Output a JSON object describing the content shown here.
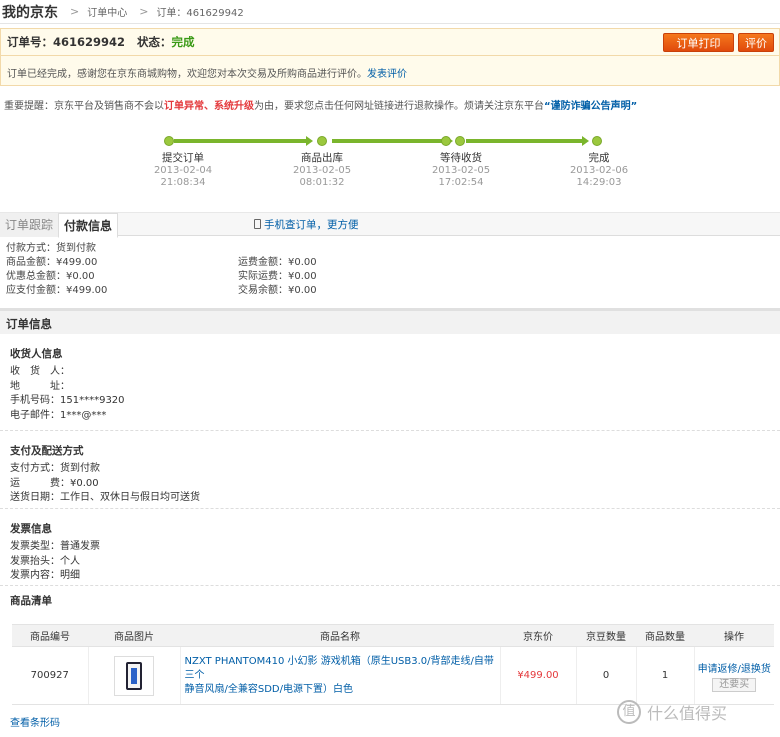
{
  "breadcrumb": {
    "home": "我的京东",
    "center": "订单中心",
    "order": "订单：461629942"
  },
  "order": {
    "number_label": "订单号：461629942",
    "status_label": "状态：",
    "status_value": "完成",
    "print_button": "订单打印",
    "rate_button": "评价",
    "message": "订单已经完成，感谢您在京东商城购物，欢迎您对本次交易及所购商品进行评价。",
    "rate_link": "发表评价"
  },
  "notice": {
    "prefix": "重要提醒：京东平台及销售商不会以",
    "red1": "订单异常",
    "mid": "、",
    "red2": "系统升级",
    "suffix": "为由，要求您点击任何网址链接进行退款操作。烦请关注京东平台",
    "link": "“谨防诈骗公告声明”"
  },
  "progress": [
    {
      "name": "提交订单",
      "date": "2013-02-04",
      "time": "21:08:34"
    },
    {
      "name": "商品出库",
      "date": "2013-02-05",
      "time": "08:01:32"
    },
    {
      "name": "等待收货",
      "date": "2013-02-05",
      "time": "17:02:54"
    },
    {
      "name": "完成",
      "date": "2013-02-06",
      "time": "14:29:03"
    }
  ],
  "tabs": {
    "tracking": "订单跟踪",
    "payment": "付款信息",
    "mobile": "手机查订单，更方便"
  },
  "payment": {
    "method": "付款方式：货到付款",
    "goods_amount": "商品金额：¥499.00",
    "discount": "优惠总金额：¥0.00",
    "due": "应支付金额：¥499.00",
    "freight": "运费金额：¥0.00",
    "actual_freight": "实际运费：¥0.00",
    "balance": "交易余额：¥0.00"
  },
  "order_info": {
    "title": "订单信息",
    "receiver": {
      "title": "收货人信息",
      "name": "收　货　人：",
      "address": "地　　　址：",
      "phone": "手机号码：151****9320",
      "email": "电子邮件：1***@***"
    },
    "delivery": {
      "title": "支付及配送方式",
      "pay": "支付方式：货到付款",
      "freight": "运　　　费：¥0.00",
      "date": "送货日期：工作日、双休日与假日均可送货"
    },
    "invoice": {
      "title": "发票信息",
      "type": "发票类型：普通发票",
      "header": "发票抬头：个人",
      "content": "发票内容：明细"
    }
  },
  "goods": {
    "title": "商品清单",
    "headers": [
      "商品编号",
      "商品图片",
      "商品名称",
      "京东价",
      "京豆数量",
      "商品数量",
      "操作"
    ],
    "row": {
      "id": "700927",
      "name_line1": "NZXT PHANTOM410 小幻影 游戏机箱（原生USB3.0/背部走线/自带三个",
      "name_line2": "静音风扇/全兼容SDD/电源下置）白色",
      "price": "¥499.00",
      "beans": "0",
      "qty": "1",
      "action": "申请返修/退换货",
      "return": "还要买"
    }
  },
  "barcode_link": "查看条形码",
  "watermark": "什么值得买",
  "watermark_glyph": "值",
  "colors": {
    "accent": "#e4393c",
    "link": "#005ea7",
    "progress": "#7ab52c",
    "button": "#e85a12"
  }
}
